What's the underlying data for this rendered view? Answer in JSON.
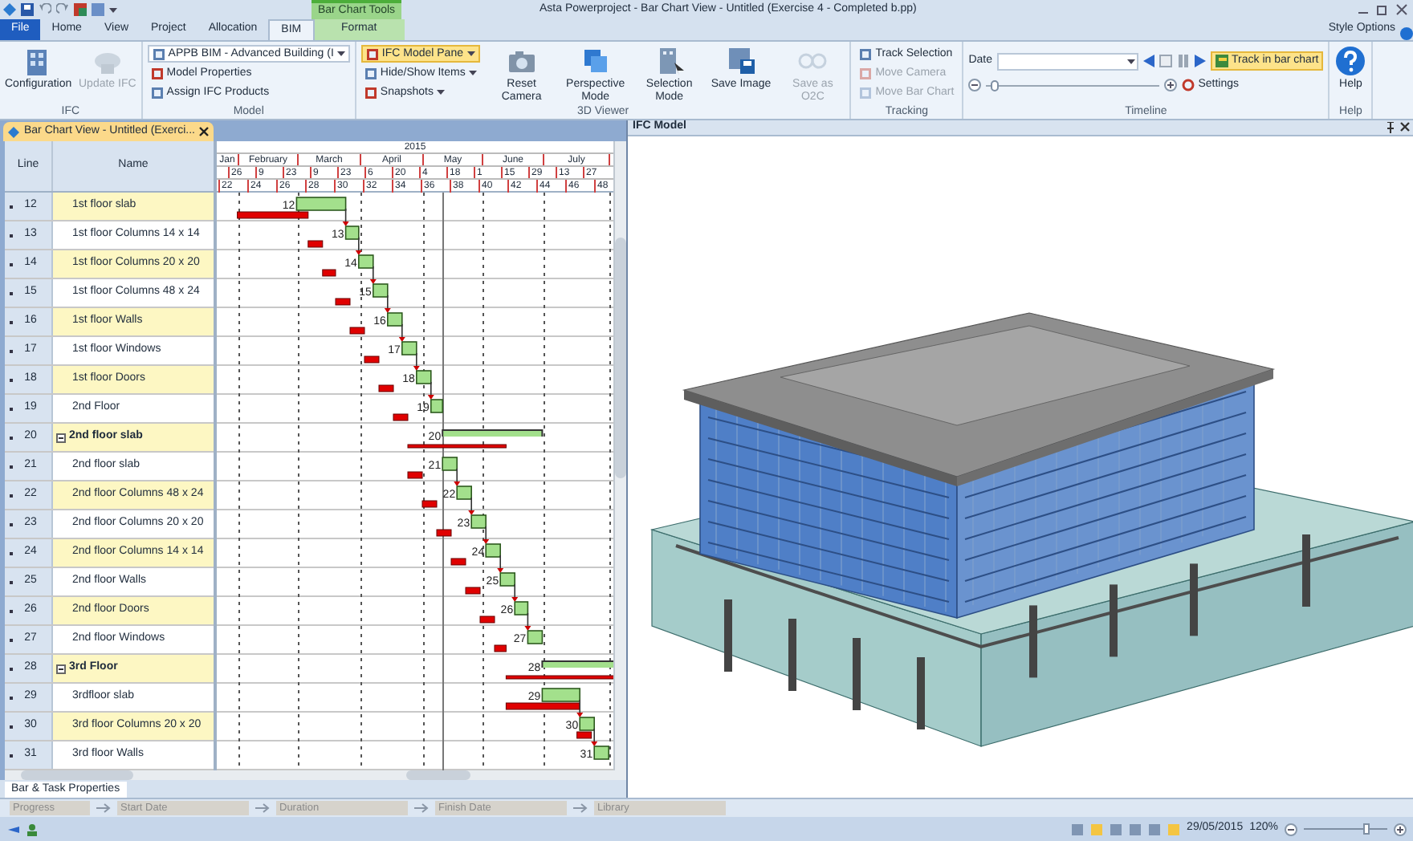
{
  "window": {
    "title": "Asta Powerproject - Bar Chart View - Untitled (Exercise 4 - Completed b.pp)"
  },
  "contextual_group": {
    "title": "Bar Chart Tools"
  },
  "tabs": [
    {
      "label": "File",
      "kind": "file",
      "selected": false
    },
    {
      "label": "Home",
      "kind": "normal",
      "selected": false
    },
    {
      "label": "View",
      "kind": "normal",
      "selected": false
    },
    {
      "label": "Project",
      "kind": "normal",
      "selected": false
    },
    {
      "label": "Allocation",
      "kind": "normal",
      "selected": false
    },
    {
      "label": "BIM",
      "kind": "normal",
      "selected": true
    },
    {
      "label": "Format",
      "kind": "contextual",
      "selected": false
    }
  ],
  "style_options": "Style Options",
  "ribbon": {
    "groups": [
      {
        "label": "IFC",
        "kind": "standard",
        "items": [
          {
            "kind": "large",
            "label": "Configuration",
            "disabled": false
          },
          {
            "kind": "large",
            "label": "Update IFC",
            "disabled": true
          }
        ]
      },
      {
        "label": "Model",
        "kind": "standard",
        "items": [
          {
            "kind": "stack",
            "items": [
              {
                "kind": "dropdown",
                "label": "APPB BIM - Advanced Building (I",
                "disabled": false,
                "on": false
              },
              {
                "kind": "small",
                "label": "Model Properties",
                "disabled": false
              },
              {
                "kind": "small",
                "label": "Assign IFC Products",
                "disabled": false
              }
            ]
          }
        ]
      },
      {
        "label": "3D Viewer",
        "kind": "standard",
        "items": [
          {
            "kind": "stack",
            "items": [
              {
                "kind": "dropdown",
                "label": "IFC Model Pane",
                "disabled": false,
                "on": true
              },
              {
                "kind": "small_menu",
                "label": "Hide/Show Items",
                "disabled": false
              },
              {
                "kind": "small_menu",
                "label": "Snapshots",
                "disabled": false
              }
            ]
          },
          {
            "kind": "large",
            "label": "Reset Camera",
            "disabled": false
          },
          {
            "kind": "large",
            "label": "Perspective Mode",
            "disabled": false
          },
          {
            "kind": "large",
            "label": "Selection Mode",
            "disabled": false
          },
          {
            "kind": "large",
            "label": "Save Image",
            "disabled": false
          },
          {
            "kind": "large",
            "label": "Save as O2C",
            "disabled": true
          }
        ]
      },
      {
        "label": "Tracking",
        "kind": "standard",
        "items": [
          {
            "kind": "stack",
            "items": [
              {
                "kind": "small",
                "label": "Track Selection",
                "disabled": false
              },
              {
                "kind": "small",
                "label": "Move Camera",
                "disabled": true
              },
              {
                "kind": "small",
                "label": "Move Bar Chart",
                "disabled": true
              }
            ]
          }
        ]
      },
      {
        "label": "Timeline",
        "kind": "timeline",
        "date_label": "Date",
        "track_button": {
          "label": "Track in bar chart",
          "on": true
        },
        "slider": {
          "level": 0.03
        },
        "settings": "Settings"
      },
      {
        "label": "Help",
        "kind": "standard",
        "items": [
          {
            "kind": "large",
            "label": "Help",
            "disabled": false
          }
        ]
      }
    ]
  },
  "document_tab": {
    "title": "Bar Chart View - Untitled (Exerci..."
  },
  "grid": {
    "columns": [
      "Line",
      "Name"
    ],
    "year": "2015",
    "months": [
      "Jan",
      "February",
      "March",
      "April",
      "May",
      "June",
      "July"
    ],
    "days": [
      "26",
      "9",
      "23",
      "9",
      "23",
      "6",
      "20",
      "4",
      "18",
      "1",
      "15",
      "29",
      "13",
      "27"
    ],
    "weeks": [
      "22",
      "24",
      "26",
      "28",
      "30",
      "32",
      "34",
      "36",
      "38",
      "40",
      "42",
      "44",
      "46",
      "48"
    ],
    "rows": [
      {
        "line": "12",
        "name": "1st floor slab",
        "kind": "task",
        "bar_label": "12"
      },
      {
        "line": "13",
        "name": "1st floor Columns 14 x 14",
        "kind": "task",
        "bar_label": "13"
      },
      {
        "line": "14",
        "name": "1st floor Columns 20 x 20",
        "kind": "task",
        "bar_label": "14"
      },
      {
        "line": "15",
        "name": "1st floor Columns 48 x 24",
        "kind": "task",
        "bar_label": "15"
      },
      {
        "line": "16",
        "name": "1st floor Walls",
        "kind": "task",
        "bar_label": "16"
      },
      {
        "line": "17",
        "name": "1st floor Windows",
        "kind": "task",
        "bar_label": "17"
      },
      {
        "line": "18",
        "name": "1st floor Doors",
        "kind": "task",
        "bar_label": "18"
      },
      {
        "line": "19",
        "name": "2nd Floor",
        "kind": "task",
        "bar_label": "19"
      },
      {
        "line": "20",
        "name": "2nd floor slab",
        "kind": "summary",
        "expanded": true,
        "bar_label": "20"
      },
      {
        "line": "21",
        "name": "2nd floor slab",
        "kind": "task",
        "bar_label": "21"
      },
      {
        "line": "22",
        "name": "2nd floor Columns 48 x 24",
        "kind": "task",
        "bar_label": "22"
      },
      {
        "line": "23",
        "name": "2nd floor Columns 20 x 20",
        "kind": "task",
        "bar_label": "23"
      },
      {
        "line": "24",
        "name": "2nd floor Columns 14 x 14",
        "kind": "task",
        "bar_label": "24"
      },
      {
        "line": "25",
        "name": "2nd floor Walls",
        "kind": "task",
        "bar_label": "25"
      },
      {
        "line": "26",
        "name": "2nd floor Doors",
        "kind": "task",
        "bar_label": "26"
      },
      {
        "line": "27",
        "name": "2nd floor Windows",
        "kind": "task",
        "bar_label": "27"
      },
      {
        "line": "28",
        "name": "3rd Floor",
        "kind": "summary",
        "expanded": true,
        "bar_label": "28"
      },
      {
        "line": "29",
        "name": "3rdfloor slab",
        "kind": "task",
        "bar_label": "29"
      },
      {
        "line": "30",
        "name": "3rd floor Columns 20 x 20",
        "kind": "task",
        "bar_label": "30"
      },
      {
        "line": "31",
        "name": "3rd floor Walls",
        "kind": "task",
        "bar_label": "31"
      }
    ]
  },
  "ifc_pane": {
    "title": "IFC Model"
  },
  "bottom_panel": {
    "tab": "Bar & Task Properties",
    "fields": [
      {
        "label": "Progress",
        "disabled": true
      },
      {
        "label": "Start Date",
        "disabled": true
      },
      {
        "label": "Duration",
        "disabled": true
      },
      {
        "label": "Finish Date",
        "disabled": true
      },
      {
        "label": "Library",
        "disabled": true
      }
    ]
  },
  "status_bar": {
    "date": "29/05/2015",
    "zoom": "120%",
    "zoom_slider": {
      "level": 0.78
    }
  }
}
